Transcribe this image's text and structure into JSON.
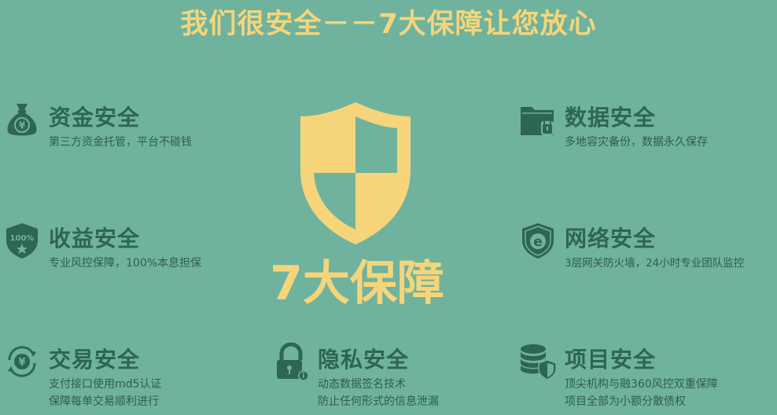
{
  "headline": "我们很安全－－7大保障让您放心",
  "center": {
    "label": "7大保障"
  },
  "features": {
    "fund": {
      "title": "资金安全",
      "lines": [
        "第三方资金托管，平台不碰钱"
      ],
      "icon": "money-bag-icon"
    },
    "income": {
      "title": "收益安全",
      "lines": [
        "专业风控保障，100%本息担保"
      ],
      "icon": "badge-100-icon",
      "icon_text": "100%"
    },
    "trade": {
      "title": "交易安全",
      "lines": [
        "支付接口使用md5认证",
        "保障每单交易顺利进行"
      ],
      "icon": "yen-cycle-icon"
    },
    "data": {
      "title": "数据安全",
      "lines": [
        "多地容灾备份，数据永久保存"
      ],
      "icon": "folder-lock-icon"
    },
    "network": {
      "title": "网络安全",
      "lines": [
        "3层网关防火墙，24小时专业团队监控"
      ],
      "icon": "shield-e-icon",
      "icon_text": "e"
    },
    "privacy": {
      "title": "隐私安全",
      "lines": [
        "动态数据签名技术",
        "防止任何形式的信息泄漏"
      ],
      "icon": "padlock-icon"
    },
    "project": {
      "title": "项目安全",
      "lines": [
        "顶尖机构与融360风控双重保障",
        "项目全部为小额分散债权"
      ],
      "icon": "database-shield-icon"
    }
  },
  "colors": {
    "background": "#6fb39e",
    "accent": "#f6d57a",
    "icon": "#2e6553",
    "text": "#2f5d4f"
  }
}
